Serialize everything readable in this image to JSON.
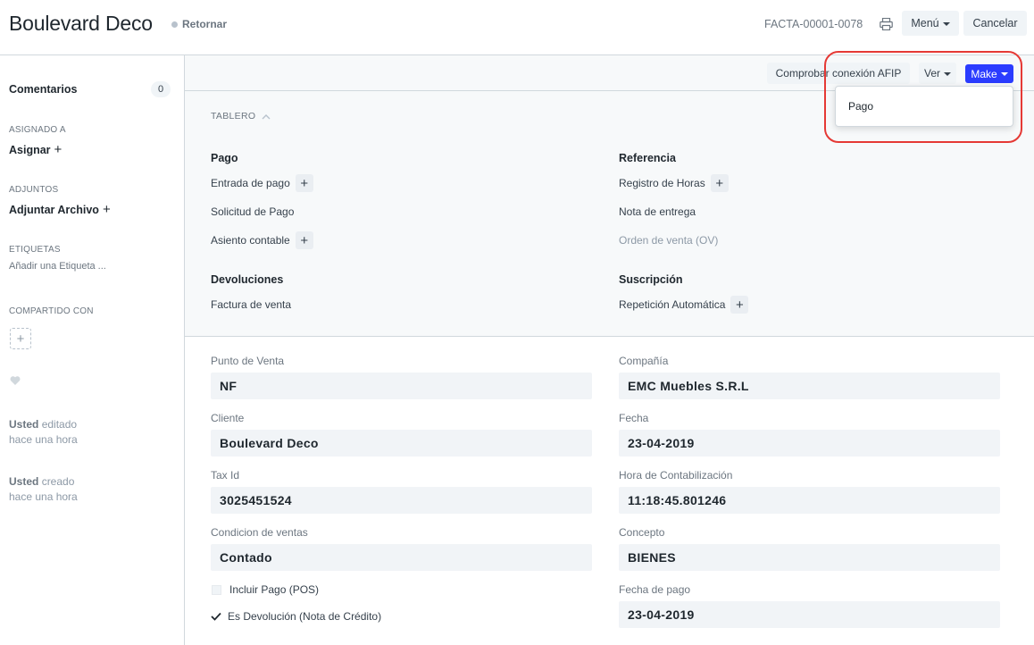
{
  "header": {
    "title": "Boulevard Deco",
    "status": "Retornar",
    "doc_name": "FACTA-00001-0078",
    "menu_label": "Menú",
    "cancel_label": "Cancelar",
    "print_icon": "printer-icon"
  },
  "sidebar": {
    "comments_label": "Comentarios",
    "comments_count": "0",
    "assigned_heading": "ASIGNADO A",
    "assign_label": "Asignar",
    "attachments_heading": "ADJUNTOS",
    "attach_label": "Adjuntar Archivo",
    "tags_heading": "ETIQUETAS",
    "tags_placeholder": "Añadir una Etiqueta ...",
    "shared_heading": "COMPARTIDO CON",
    "timeline": [
      {
        "user": "Usted",
        "action": "editado",
        "time": "hace una hora"
      },
      {
        "user": "Usted",
        "action": "creado",
        "time": "hace una hora"
      }
    ]
  },
  "actions": {
    "check_afip": "Comprobar conexión AFIP",
    "view": "Ver",
    "make": "Make",
    "make_menu": [
      "Pago"
    ]
  },
  "dashboard": {
    "heading": "TABLERO",
    "groups": [
      {
        "title": "Pago",
        "links": [
          {
            "label": "Entrada de pago",
            "add": true
          },
          {
            "label": "Solicitud de Pago",
            "add": false
          },
          {
            "label": "Asiento contable",
            "add": true
          }
        ]
      },
      {
        "title": "Referencia",
        "links": [
          {
            "label": "Registro de Horas",
            "add": true
          },
          {
            "label": "Nota de entrega",
            "add": false
          },
          {
            "label": "Orden de venta (OV)",
            "add": false,
            "muted": true
          }
        ]
      },
      {
        "title": "Devoluciones",
        "links": [
          {
            "label": "Factura de venta",
            "add": false
          }
        ]
      },
      {
        "title": "Suscripción",
        "links": [
          {
            "label": "Repetición Automática",
            "add": true
          }
        ]
      }
    ]
  },
  "form": {
    "punto_venta": {
      "label": "Punto de Venta",
      "value": "NF"
    },
    "compania": {
      "label": "Compañía",
      "value": "EMC Muebles S.R.L"
    },
    "cliente": {
      "label": "Cliente",
      "value": "Boulevard Deco"
    },
    "fecha": {
      "label": "Fecha",
      "value": "23-04-2019"
    },
    "tax_id": {
      "label": "Tax Id",
      "value": "3025451524"
    },
    "hora": {
      "label": "Hora de Contabilización",
      "value": "11:18:45.801246"
    },
    "condicion": {
      "label": "Condicion de ventas",
      "value": "Contado"
    },
    "concepto": {
      "label": "Concepto",
      "value": "BIENES"
    },
    "incluir_pago": {
      "label": "Incluir Pago (POS)",
      "checked": false
    },
    "es_devolucion": {
      "label": "Es Devolución (Nota de Crédito)",
      "checked": true
    },
    "fecha_pago": {
      "label": "Fecha de pago",
      "value": "23-04-2019"
    }
  },
  "colors": {
    "primary": "#2b3cff",
    "highlight": "#e53935"
  }
}
